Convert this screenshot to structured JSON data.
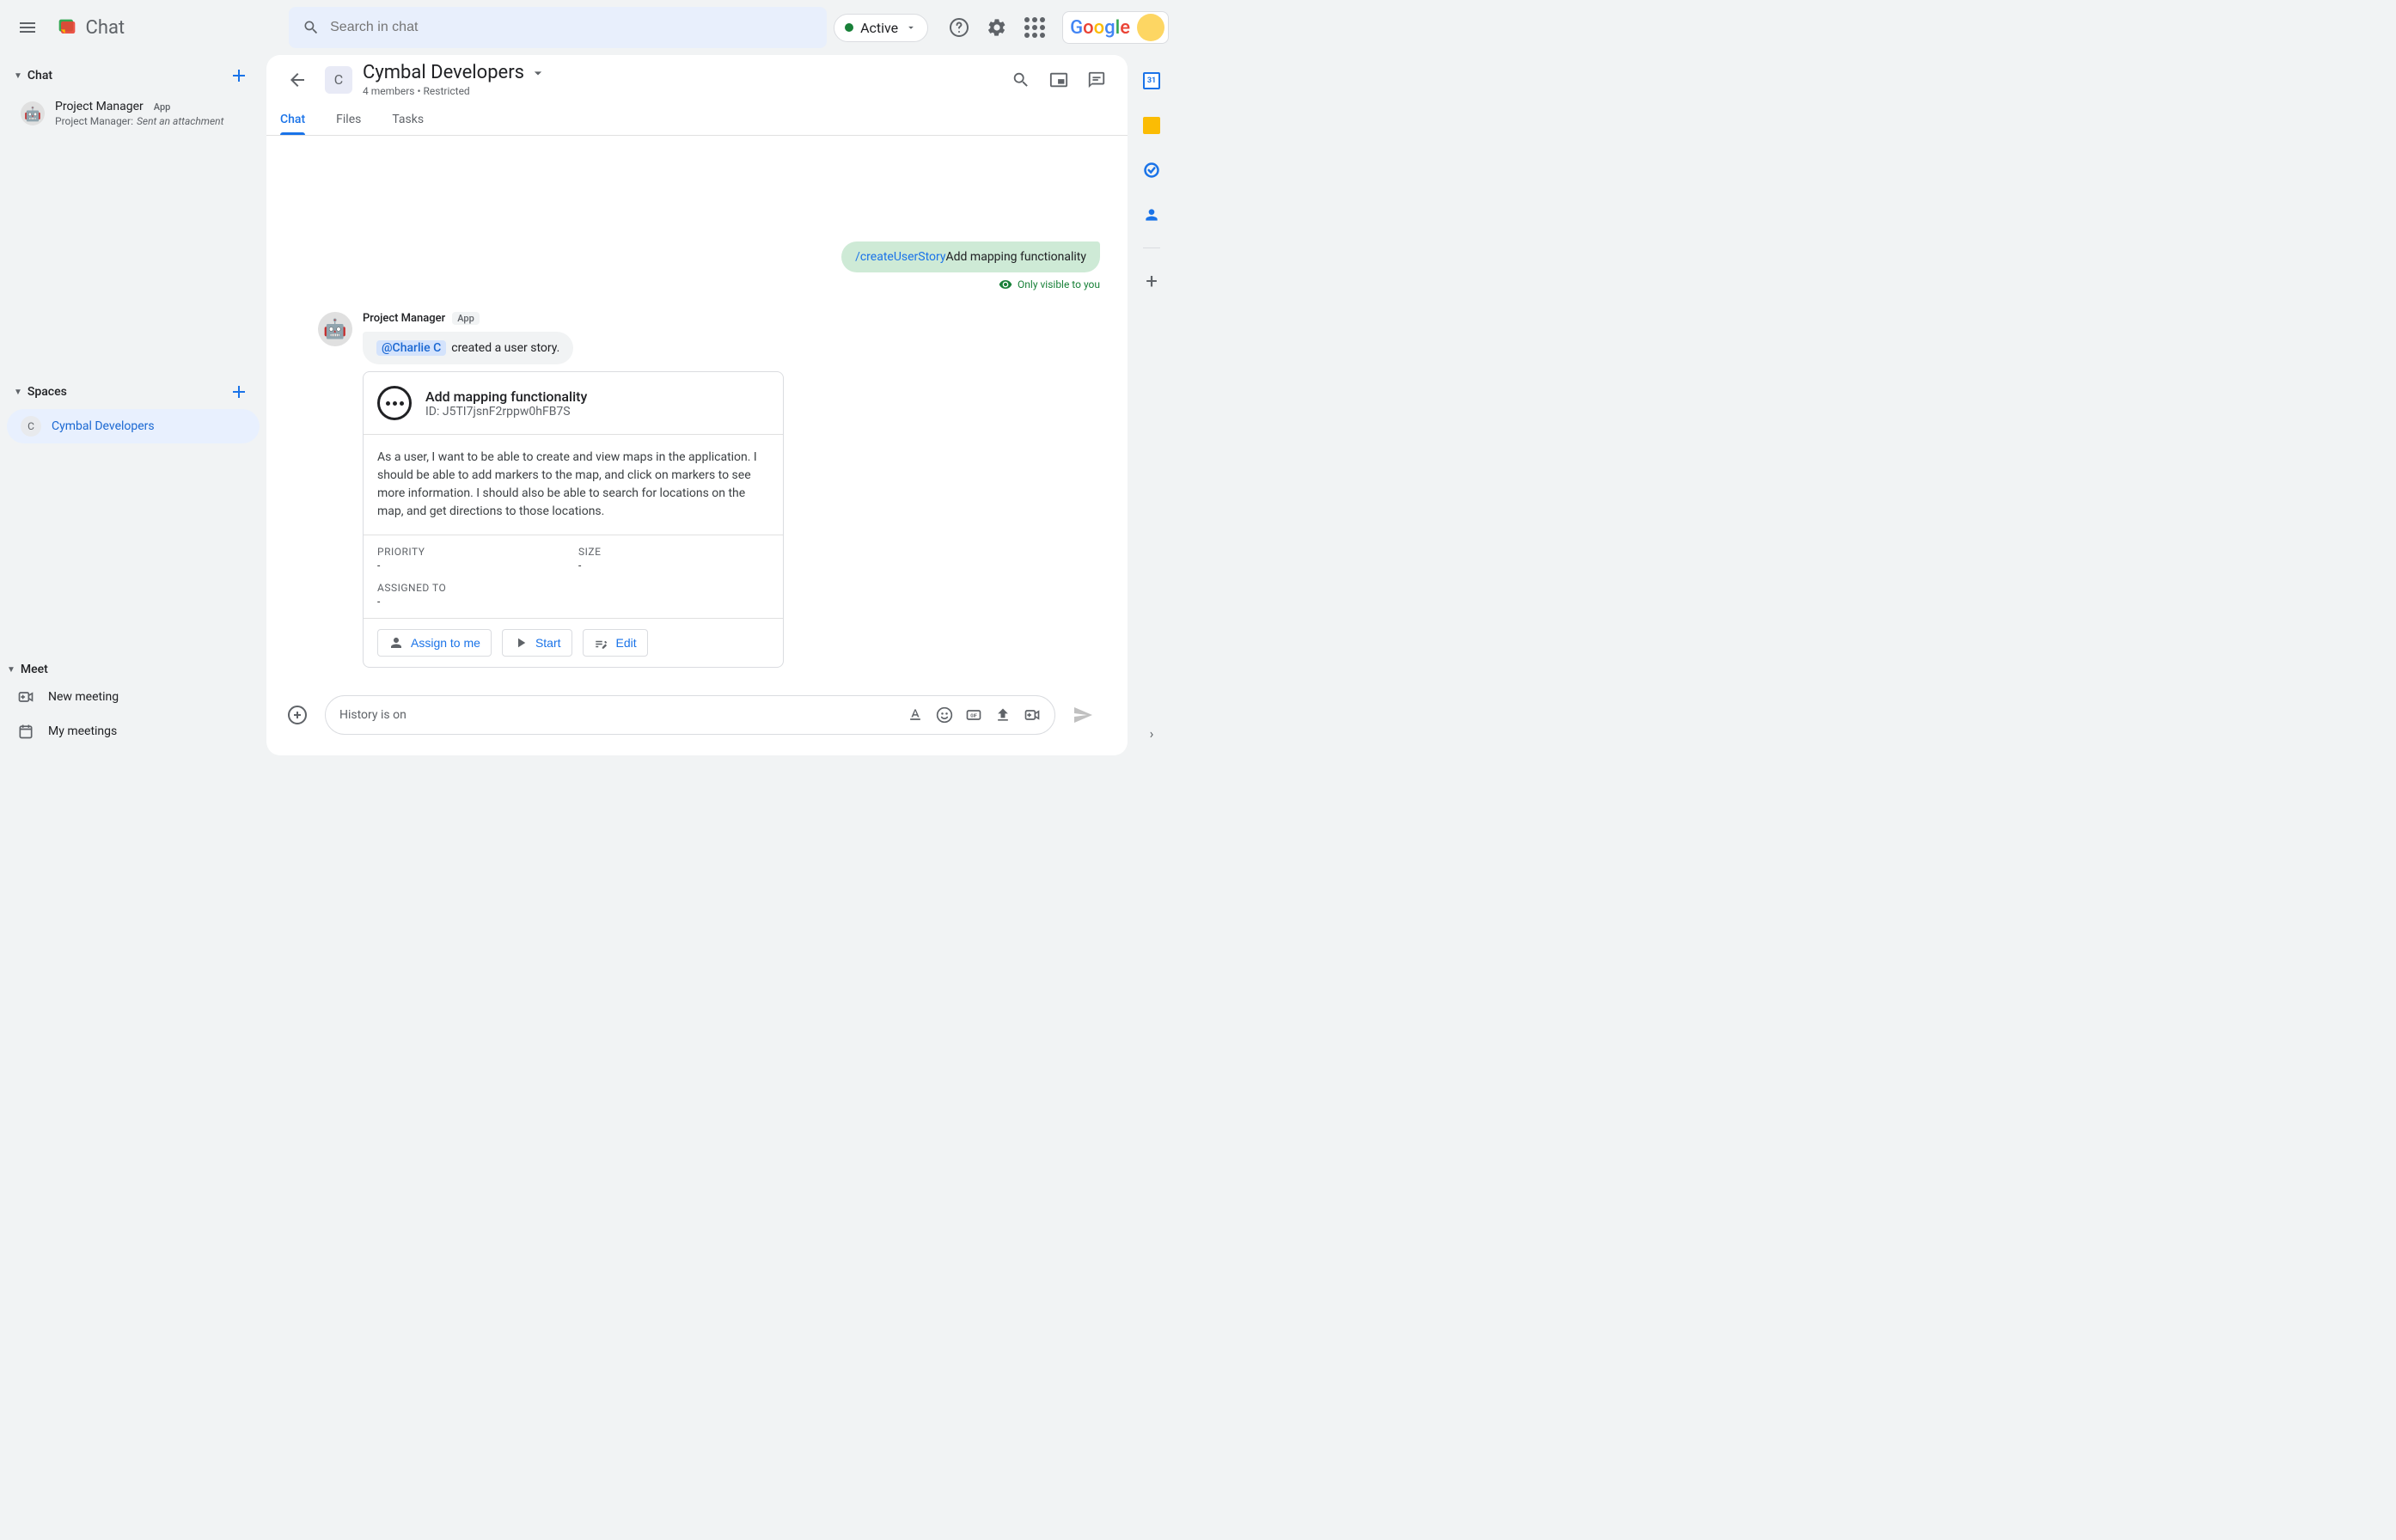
{
  "header": {
    "title": "Chat",
    "search_placeholder": "Search in chat",
    "status": "Active",
    "google": "Google"
  },
  "nav": {
    "chat_label": "Chat",
    "pm_name": "Project Manager",
    "pm_badge": "App",
    "pm_sub_prefix": "Project Manager:",
    "pm_sub_action": "Sent an attachment",
    "spaces_label": "Spaces",
    "space_initial": "C",
    "space_name": "Cymbal Developers",
    "meet_label": "Meet",
    "new_meeting": "New meeting",
    "my_meetings": "My meetings"
  },
  "main": {
    "title": "Cymbal Developers",
    "meta": "4 members  •  Restricted",
    "tabs": {
      "chat": "Chat",
      "files": "Files",
      "tasks": "Tasks"
    }
  },
  "messages": {
    "self_cmd": "/createUserStory",
    "self_text": "Add mapping functionality",
    "visibility": "Only visible to you",
    "bot_name": "Project Manager",
    "bot_badge": "App",
    "mention": "@Charlie C",
    "bot_text": "created a user story."
  },
  "card": {
    "title": "Add mapping functionality",
    "id": "ID: J5TI7jsnF2rppw0hFB7S",
    "body": "As a user, I want to be able to create and view maps in the application. I should be able to add markers to the map, and click on markers to see more information. I should also be able to search for locations on the map, and get directions to those locations.",
    "priority_label": "PRIORITY",
    "priority_val": "-",
    "size_label": "SIZE",
    "size_val": "-",
    "assigned_label": "ASSIGNED TO",
    "assigned_val": "-",
    "assign_btn": "Assign to me",
    "start_btn": "Start",
    "edit_btn": "Edit"
  },
  "composer": {
    "placeholder": "History is on"
  },
  "side": {
    "cal_day": "31"
  }
}
